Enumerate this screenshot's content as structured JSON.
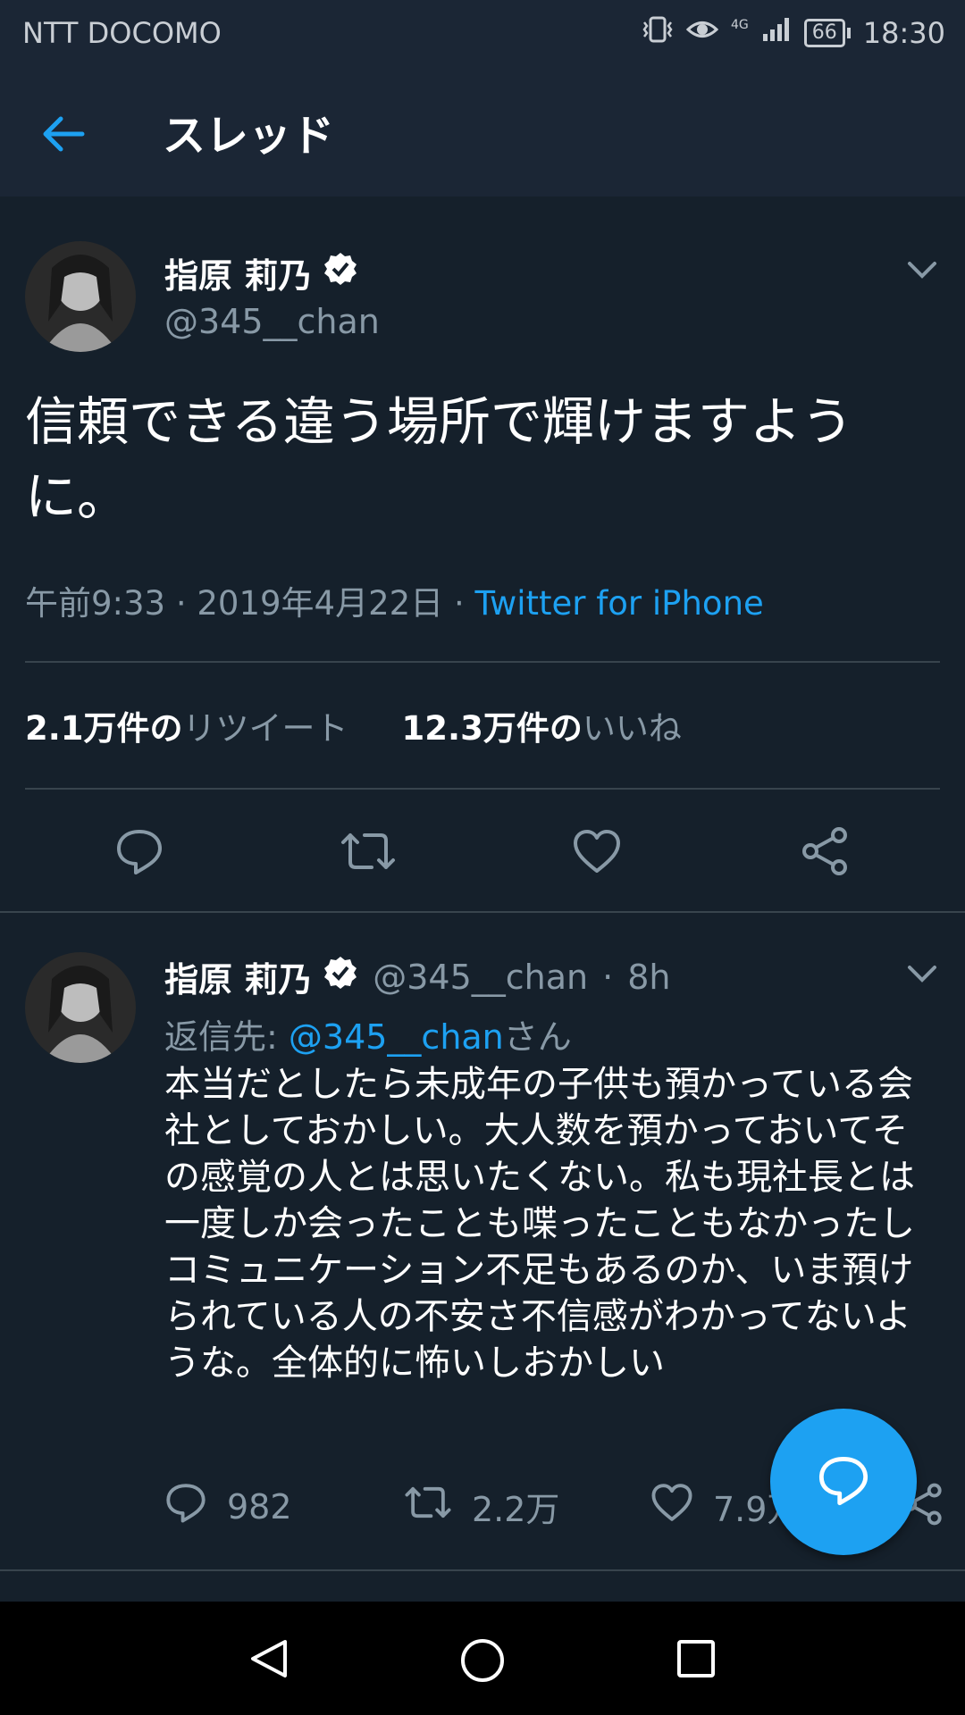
{
  "status_bar": {
    "carrier": "NTT DOCOMO",
    "network": "4G",
    "battery": "66",
    "time": "18:30"
  },
  "header": {
    "title": "スレッド"
  },
  "tweet": {
    "display_name": "指原 莉乃",
    "handle": "@345__chan",
    "text": "信頼できる違う場所で輝けますように。",
    "time": "午前9:33",
    "sep1": " · ",
    "date": "2019年4月22日",
    "sep2": " · ",
    "source": "Twitter for iPhone",
    "retweets_count": "2.1万件の",
    "retweets_label": "リツイート",
    "likes_count": "12.3万件の",
    "likes_label": "いいね"
  },
  "reply": {
    "display_name": "指原 莉乃",
    "handle": "@345__chan",
    "dot": "·",
    "age": "8h",
    "reply_prefix": "返信先: ",
    "reply_to": "@345__chan",
    "reply_suffix": "さん",
    "text": "本当だとしたら未成年の子供も預かっている会社としておかしい。大人数を預かっておいてその感覚の人とは思いたくない。私も現社長とは一度しか会ったことも喋ったこともなかったしコミュニケーション不足もあるのか、いま預けられている人の不安さ不信感がわかってないような。全体的に怖いしおかしい",
    "replies": "982",
    "retweets": "2.2万",
    "likes": "7.9万"
  },
  "colors": {
    "background": "#15202b",
    "header": "#1b2635",
    "accent": "#1da1f2",
    "muted": "#8899a6"
  }
}
